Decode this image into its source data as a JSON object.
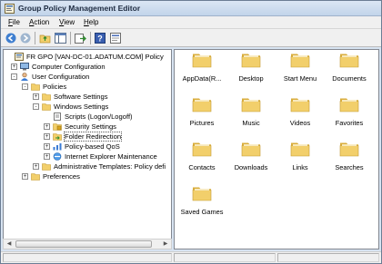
{
  "window": {
    "title": "Group Policy Management Editor"
  },
  "menu": [
    {
      "label": "File",
      "accel": "F",
      "rest": "ile"
    },
    {
      "label": "Action",
      "accel": "A",
      "rest": "ction"
    },
    {
      "label": "View",
      "accel": "V",
      "rest": "iew"
    },
    {
      "label": "Help",
      "accel": "H",
      "rest": "elp"
    }
  ],
  "toolbar": {
    "buttons": [
      "back-icon",
      "forward-icon",
      "up-folder-icon",
      "show-hide-tree-icon",
      "export-list-icon",
      "help-icon",
      "properties-icon"
    ]
  },
  "tree": [
    {
      "label": "FR GPO [VAN-DC-01.ADATUM.COM] Policy",
      "icon": "gpo-icon",
      "expander": "none"
    },
    {
      "label": "Computer Configuration",
      "icon": "computer-icon",
      "expander": "+"
    },
    {
      "label": "User Configuration",
      "icon": "user-icon",
      "expander": "-"
    },
    {
      "label": "Policies",
      "icon": "folder-icon",
      "expander": "-"
    },
    {
      "label": "Software Settings",
      "icon": "folder-icon",
      "expander": "+"
    },
    {
      "label": "Windows Settings",
      "icon": "folder-icon",
      "expander": "-"
    },
    {
      "label": "Scripts (Logon/Logoff)",
      "icon": "script-icon",
      "expander": "none"
    },
    {
      "label": "Security Settings",
      "icon": "security-icon",
      "expander": "+"
    },
    {
      "label": "Folder Redirection",
      "icon": "folder-redirect-icon",
      "expander": "+"
    },
    {
      "label": "Policy-based QoS",
      "icon": "qos-icon",
      "expander": "+"
    },
    {
      "label": "Internet Explorer Maintenance",
      "icon": "ie-icon",
      "expander": "+"
    },
    {
      "label": "Administrative Templates: Policy defi",
      "icon": "folder-icon",
      "expander": "+"
    },
    {
      "label": "Preferences",
      "icon": "folder-icon",
      "expander": "+"
    }
  ],
  "folders": [
    "AppData(R...",
    "Desktop",
    "Start Menu",
    "Documents",
    "Pictures",
    "Music",
    "Videos",
    "Favorites",
    "Contacts",
    "Downloads",
    "Links",
    "Searches",
    "Saved Games"
  ],
  "colors": {
    "folder": "#f2cf6b",
    "folder_dark": "#d9ad3c",
    "selection": "#cfe3f8"
  }
}
